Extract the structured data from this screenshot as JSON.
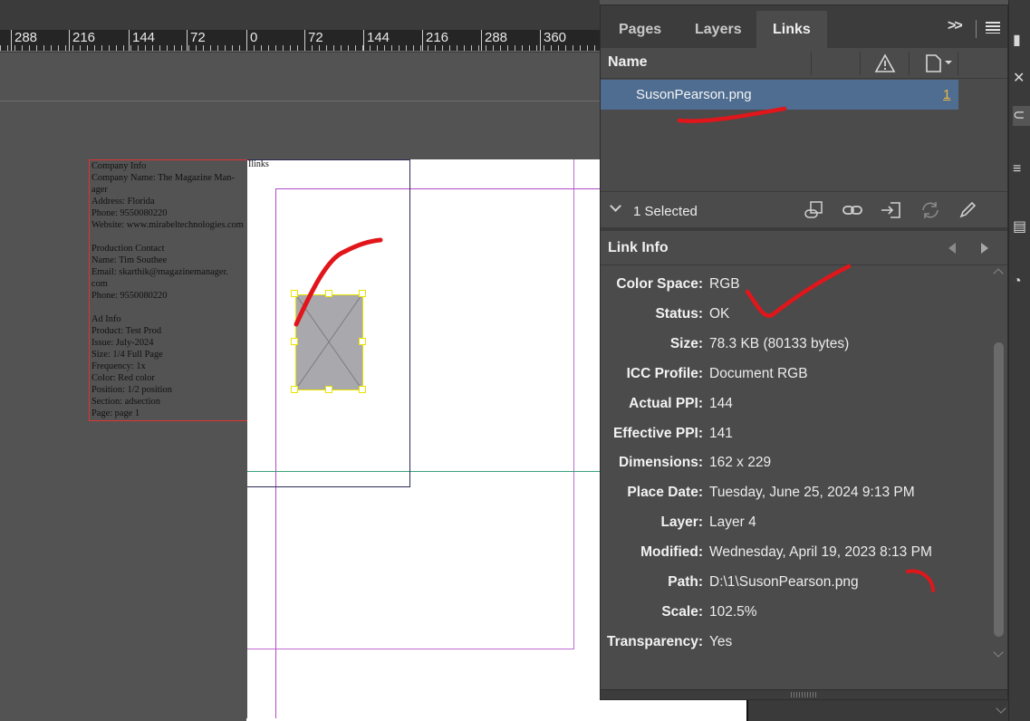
{
  "ruler": {
    "ticks": [
      "288",
      "216",
      "144",
      "72",
      "0",
      "72",
      "144",
      "216",
      "288",
      "360"
    ]
  },
  "document": {
    "frame_label": "Ilinks",
    "info_lines": [
      "Company Info",
      "Company Name: The Magazine Man-",
      "ager",
      "Address: Florida",
      "Phone: 9550080220",
      "Website: www.mirabeltechnologies.com",
      "",
      "Production Contact",
      "Name: Tim Southee",
      "Email: skarthik@magazinemanager.",
      "com",
      "Phone: 9550080220",
      "",
      "Ad Info",
      "Product: Test Prod",
      "Issue: July-2024",
      "Size: 1/4 Full Page",
      "Frequency: 1x",
      "Color: Red color",
      "Position: 1/2 position",
      "Section: adsection",
      "Page: page 1"
    ]
  },
  "panel": {
    "tabs": [
      "Pages",
      "Layers",
      "Links"
    ],
    "active_tab": "Links",
    "more_label": ">>",
    "column_name": "Name",
    "links": [
      {
        "name": "SusonPearson.png",
        "page": "1"
      }
    ],
    "selected_label": "1 Selected",
    "link_info_title": "Link Info",
    "info": [
      {
        "label": "Color Space:",
        "value": "RGB"
      },
      {
        "label": "Status:",
        "value": "OK"
      },
      {
        "label": "Size:",
        "value": "78.3 KB (80133 bytes)"
      },
      {
        "label": "ICC Profile:",
        "value": "Document RGB"
      },
      {
        "label": "Actual PPI:",
        "value": "144"
      },
      {
        "label": "Effective PPI:",
        "value": "141"
      },
      {
        "label": "Dimensions:",
        "value": "162 x 229"
      },
      {
        "label": "Place Date:",
        "value": "Tuesday, June 25, 2024 9:13 PM"
      },
      {
        "label": "Layer:",
        "value": "Layer 4"
      },
      {
        "label": "Modified:",
        "value": "Wednesday, April 19, 2023 8:13 PM"
      },
      {
        "label": "Path:",
        "value": "D:\\1\\SusonPearson.png"
      },
      {
        "label": "Scale:",
        "value": "102.5%"
      },
      {
        "label": "Transparency:",
        "value": "Yes"
      }
    ]
  },
  "icons": {
    "toolbar": [
      "relink-from-cc-icon",
      "relink-icon",
      "goto-link-icon",
      "update-link-icon",
      "edit-original-icon"
    ],
    "header": [
      "warning-icon",
      "page-icon"
    ]
  },
  "colors": {
    "selection": "#4e6d91",
    "annotation": "#e0161b",
    "frame_handle": "#e8e400",
    "page_number": "#e8b844"
  }
}
